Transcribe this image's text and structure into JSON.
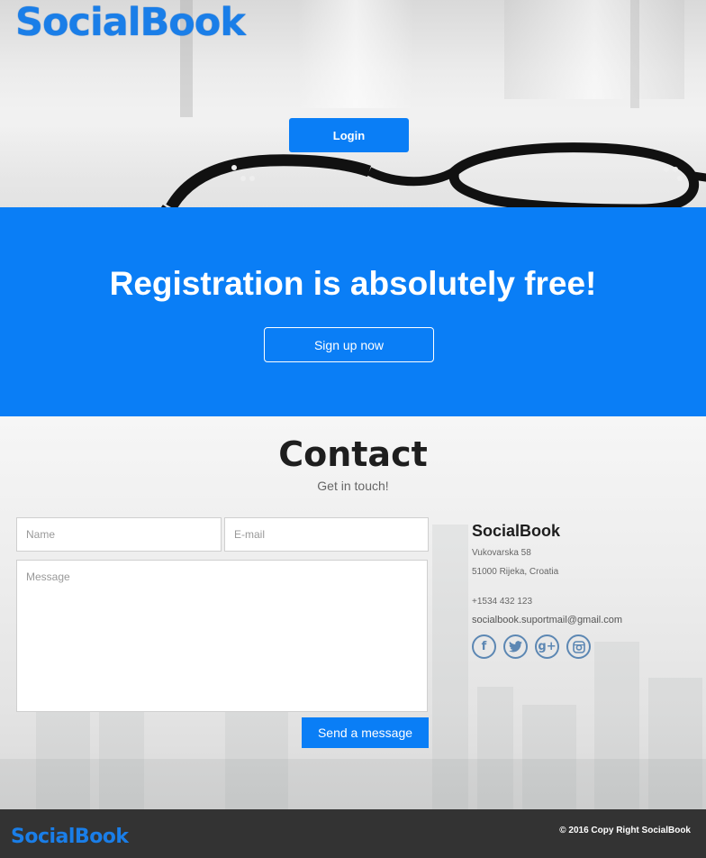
{
  "brand": {
    "name": "SocialBook",
    "accent_color": "#0a7ef6"
  },
  "hero": {
    "login_label": "Login"
  },
  "registration": {
    "title": "Registration is absolutely free!",
    "signup_label": "Sign up now"
  },
  "contact": {
    "title": "Contact",
    "subtitle": "Get in touch!",
    "form": {
      "name_placeholder": "Name",
      "email_placeholder": "E-mail",
      "message_placeholder": "Message",
      "send_label": "Send a message"
    },
    "info": {
      "company": "SocialBook",
      "street": "Vukovarska 58",
      "city": "51000 Rijeka, Croatia",
      "phone": "+1534 432 123",
      "email": "socialbook.suportmail@gmail.com"
    },
    "social": [
      {
        "name": "facebook-icon",
        "glyph": "f"
      },
      {
        "name": "twitter-icon",
        "glyph": "t"
      },
      {
        "name": "google-plus-icon",
        "glyph": "g+"
      },
      {
        "name": "instagram-icon",
        "glyph": "◘"
      }
    ]
  },
  "footer": {
    "copyright": "© 2016 Copy Right SocialBook"
  }
}
